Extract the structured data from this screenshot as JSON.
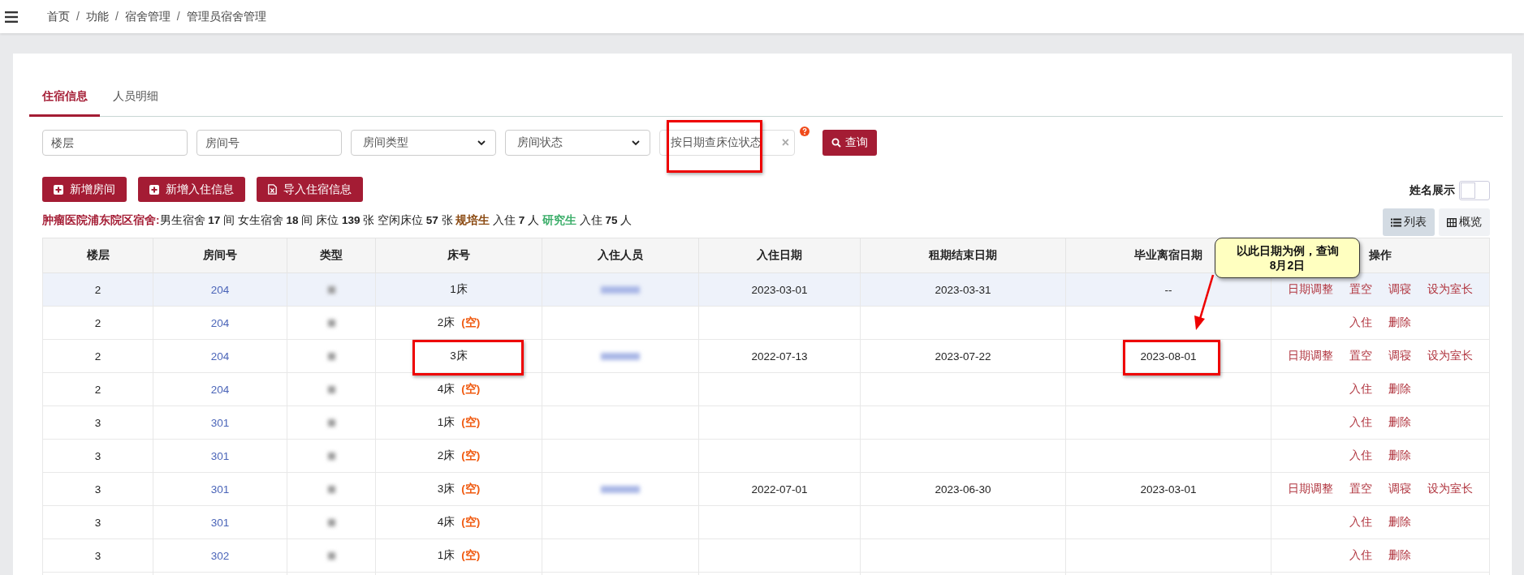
{
  "breadcrumb": {
    "separator": "/",
    "items": [
      "首页",
      "功能",
      "宿舍管理",
      "管理员宿舍管理"
    ]
  },
  "tabs": [
    {
      "label": "住宿信息",
      "selected": true
    },
    {
      "label": "人员明细",
      "selected": false
    }
  ],
  "filters": [
    {
      "kind": "input",
      "placeholder": "楼层"
    },
    {
      "kind": "input",
      "placeholder": "房间号"
    },
    {
      "kind": "select",
      "placeholder": "房间类型"
    },
    {
      "kind": "select",
      "placeholder": "房间状态"
    },
    {
      "kind": "date",
      "placeholder": "按日期查床位状态",
      "clear": "×",
      "boxed": true
    }
  ],
  "search_button": "查询",
  "action_buttons": [
    {
      "kind": "plus",
      "label": "新增房间"
    },
    {
      "kind": "plus",
      "label": "新增入住信息"
    },
    {
      "kind": "import",
      "label": "导入住宿信息"
    }
  ],
  "name_toggle": {
    "label": "姓名展示",
    "on": false
  },
  "views": [
    {
      "kind": "list",
      "label": "列表",
      "selected": true
    },
    {
      "kind": "grid",
      "label": "概览",
      "selected": false
    }
  ],
  "stats": [
    {
      "kind": "title",
      "text": "肿瘤医院浦东院区宿舍:"
    },
    {
      "kind": "text",
      "text": "男生宿舍"
    },
    {
      "kind": "number",
      "text": "17"
    },
    {
      "kind": "text",
      "text": "间 女生宿舍"
    },
    {
      "kind": "number",
      "text": "18"
    },
    {
      "kind": "text",
      "text": "间 床位"
    },
    {
      "kind": "number",
      "text": "139"
    },
    {
      "kind": "text",
      "text": "张 空闲床位"
    },
    {
      "kind": "number",
      "text": "57"
    },
    {
      "kind": "text",
      "text": "张"
    },
    {
      "kind": "category",
      "text": "规培生",
      "color": "#8b4a12"
    },
    {
      "kind": "text",
      "text": "入住"
    },
    {
      "kind": "number",
      "text": "7"
    },
    {
      "kind": "text",
      "text": "人"
    },
    {
      "kind": "category",
      "text": "研究生",
      "color": "#3cae6a"
    },
    {
      "kind": "text",
      "text": "入住"
    },
    {
      "kind": "number",
      "text": "75"
    },
    {
      "kind": "text",
      "text": "人"
    }
  ],
  "table": {
    "columns": [
      "楼层",
      "房间号",
      "类型",
      "床号",
      "入住人员",
      "入住日期",
      "租期结束日期",
      "毕业离宿日期",
      "操作"
    ],
    "rows": [
      {
        "floor": "2",
        "room": "204",
        "type_blurred": true,
        "bed": "1床",
        "occupant_blurred": true,
        "checkin": "2023-03-01",
        "lease_end": "2023-03-31",
        "graduation": "--",
        "actions": [
          "日期调整",
          "置空",
          "调寝",
          "设为室长"
        ],
        "highlighted": true,
        "bed_boxed": false,
        "graduation_boxed": false
      },
      {
        "floor": "2",
        "room": "204",
        "type_blurred": true,
        "bed": "2床",
        "empty": "(空)",
        "occupant_blurred": false,
        "actions": [
          "入住",
          "删除"
        ],
        "highlighted": false,
        "bed_boxed": false,
        "graduation_boxed": false
      },
      {
        "floor": "2",
        "room": "204",
        "type_blurred": true,
        "bed": "3床",
        "occupant_blurred": true,
        "checkin": "2022-07-13",
        "lease_end": "2023-07-22",
        "graduation": "2023-08-01",
        "actions": [
          "日期调整",
          "置空",
          "调寝",
          "设为室长"
        ],
        "highlighted": false,
        "bed_boxed": true,
        "graduation_boxed": true
      },
      {
        "floor": "2",
        "room": "204",
        "type_blurred": true,
        "bed": "4床",
        "empty": "(空)",
        "occupant_blurred": false,
        "actions": [
          "入住",
          "删除"
        ],
        "highlighted": false,
        "bed_boxed": false,
        "graduation_boxed": false
      },
      {
        "floor": "3",
        "room": "301",
        "type_blurred": true,
        "bed": "1床",
        "empty": "(空)",
        "occupant_blurred": false,
        "actions": [
          "入住",
          "删除"
        ],
        "highlighted": false,
        "bed_boxed": false,
        "graduation_boxed": false
      },
      {
        "floor": "3",
        "room": "301",
        "type_blurred": true,
        "bed": "2床",
        "empty": "(空)",
        "occupant_blurred": false,
        "actions": [
          "入住",
          "删除"
        ],
        "highlighted": false,
        "bed_boxed": false,
        "graduation_boxed": false
      },
      {
        "floor": "3",
        "room": "301",
        "type_blurred": true,
        "bed": "3床",
        "empty": "(空)",
        "occupant_blurred": true,
        "checkin": "2022-07-01",
        "lease_end": "2023-06-30",
        "graduation": "2023-03-01",
        "actions": [
          "日期调整",
          "置空",
          "调寝",
          "设为室长"
        ],
        "highlighted": false,
        "bed_boxed": false,
        "graduation_boxed": false
      },
      {
        "floor": "3",
        "room": "301",
        "type_blurred": true,
        "bed": "4床",
        "empty": "(空)",
        "occupant_blurred": false,
        "actions": [
          "入住",
          "删除"
        ],
        "highlighted": false,
        "bed_boxed": false,
        "graduation_boxed": false
      },
      {
        "floor": "3",
        "room": "302",
        "type_blurred": true,
        "bed": "1床",
        "empty": "(空)",
        "occupant_blurred": false,
        "actions": [
          "入住",
          "删除"
        ],
        "highlighted": false,
        "bed_boxed": false,
        "graduation_boxed": false
      }
    ]
  },
  "callout": {
    "lines": [
      "以此日期为例，查询",
      "8月2日"
    ]
  }
}
